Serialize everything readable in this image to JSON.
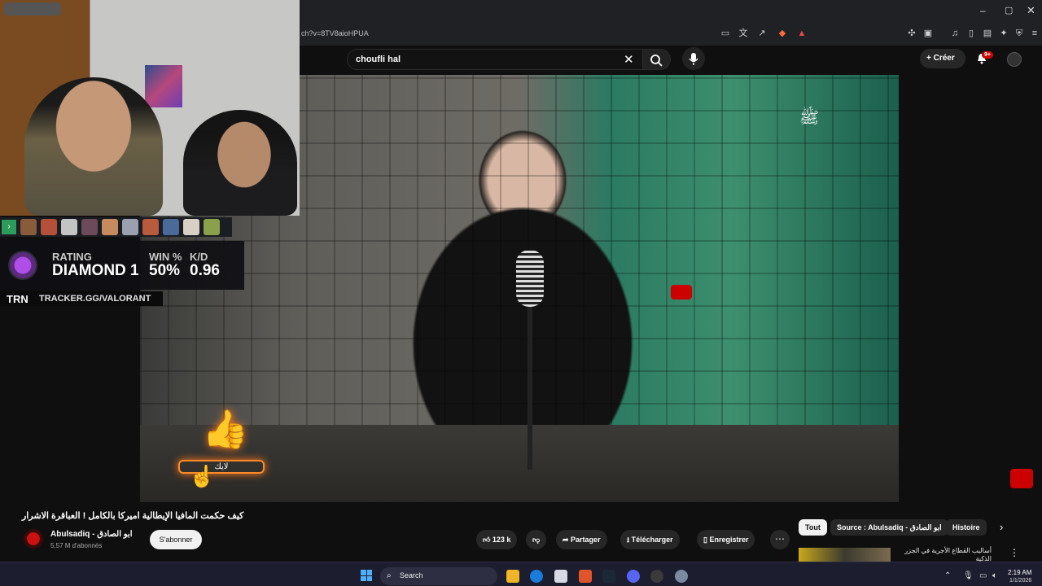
{
  "browser": {
    "url": "ch?v=8TV8aioHPUA",
    "window_controls": {
      "minimize": "–",
      "maximize": "▢",
      "close": "✕"
    }
  },
  "youtube": {
    "search": {
      "value": "choufli hal",
      "clear_icon": "close-icon",
      "search_icon": "search-icon",
      "mic_icon": "mic-icon"
    },
    "create_label": "Créer",
    "notifications_badge": "9+",
    "video": {
      "title": "كيف حكمت المافيا الإيطالية اميركا بالكامل ! العباقرة الاشرار"
    },
    "channel": {
      "name": "Abulsadiq - ابو الصادق",
      "subscribers": "5,57 M d'abonnés",
      "subscribe_label": "S'abonner"
    },
    "actions": {
      "likes": "123 k",
      "share": "Partager",
      "download": "Télécharger",
      "save": "Enregistrer",
      "more": "⋯"
    },
    "chips": {
      "all": "Tout",
      "source": "Source : Abulsadiq - ابو الصادق",
      "history": "Histoire",
      "next_icon": "chevron-right-icon"
    },
    "recommendation": {
      "title": "أساليب القطاع الأجرية في الجزر الذكية",
      "more": "⋮"
    }
  },
  "stream_overlay": {
    "tracker": {
      "rating_label": "RATING",
      "rating_value": "DIAMOND 1",
      "win_label": "WIN %",
      "win_value": "50%",
      "kd_label": "K/D",
      "kd_value": "0.96",
      "brand": "TRN",
      "url": "TRACKER.GG/VALORANT"
    },
    "like_overlay_label": "لايك",
    "agents_arrow": "›"
  },
  "taskbar": {
    "search_label": "Search",
    "time": "2:19 AM",
    "date": "1/1/2026"
  }
}
